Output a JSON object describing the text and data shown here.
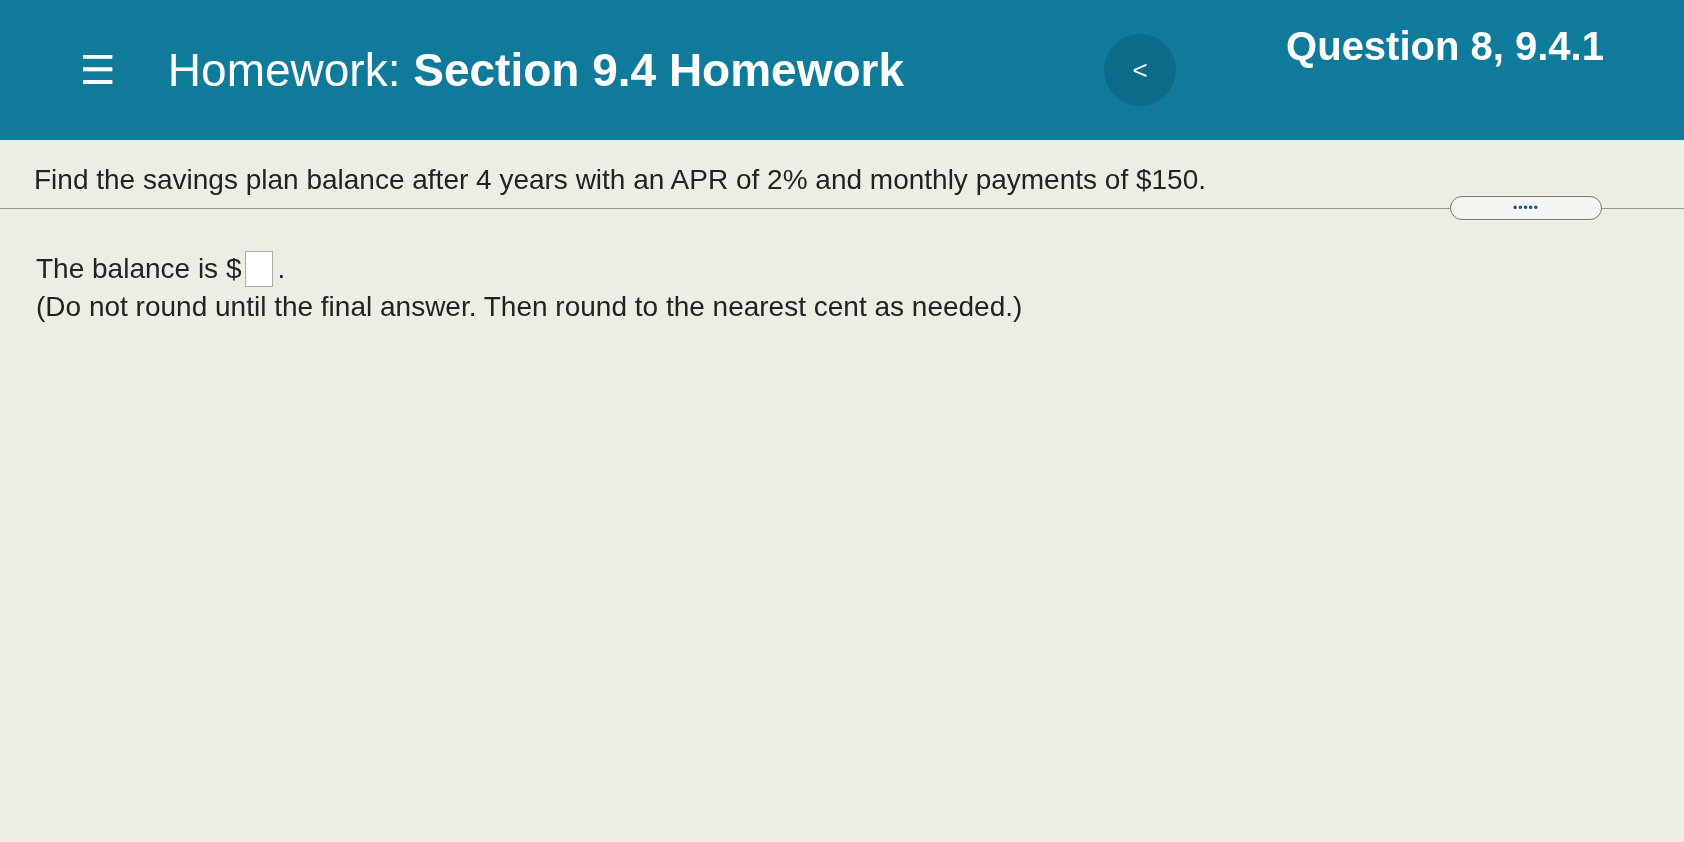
{
  "header": {
    "menu_icon": "☰",
    "title": "Homework: **Section 9.4 Homework**",
    "back": "<",
    "question_label": "Question 8, 9.4.1"
  },
  "question": {
    "prompt": "Find the savings plan balance after 4 years with an APR of 2% and monthly payments of $150.",
    "more": "•••••"
  },
  "answer": {
    "before": "The balance is $",
    "after": ".",
    "note": "(Do not round until the final answer. Then round to the nearest cent as needed.)"
  }
}
